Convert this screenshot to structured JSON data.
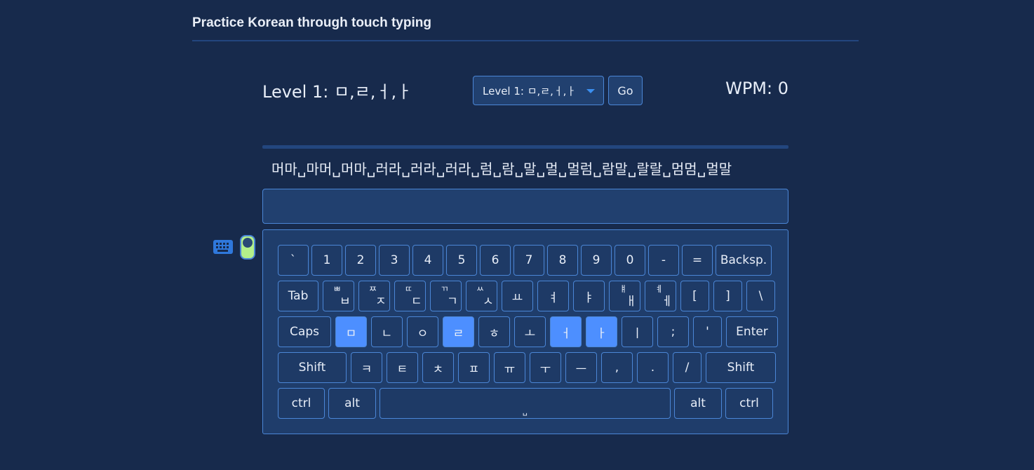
{
  "header": {
    "title": "Practice Korean through touch typing"
  },
  "controls": {
    "level_heading": "Level 1: ㅁ,ㄹ,ㅓ,ㅏ",
    "level_select": "Level 1: ㅁ,ㄹ,ㅓ,ㅏ",
    "go_label": "Go",
    "wpm": "WPM: 0"
  },
  "lesson": {
    "target_text": "머마␣마머␣머마␣러라␣러라␣러라␣럼␣람␣말␣멀␣멀럼␣람말␣랄랄␣멈멈␣멀말",
    "input_value": "",
    "progress": 0
  },
  "toggle": {
    "on": true,
    "icon": "keyboard-icon"
  },
  "colors": {
    "highlight": "#4d8fff",
    "toggle_on": "#b3f08a",
    "background": "#172a4c"
  },
  "keyboard": {
    "rows": [
      [
        {
          "label": "`"
        },
        {
          "label": "1"
        },
        {
          "label": "2"
        },
        {
          "label": "3"
        },
        {
          "label": "4"
        },
        {
          "label": "5"
        },
        {
          "label": "6"
        },
        {
          "label": "7"
        },
        {
          "label": "8"
        },
        {
          "label": "9"
        },
        {
          "label": "0"
        },
        {
          "label": "-"
        },
        {
          "label": "="
        },
        {
          "label": "Backsp."
        }
      ],
      [
        {
          "label": "Tab"
        },
        {
          "label": "ㅂ",
          "shift": "ㅃ"
        },
        {
          "label": "ㅈ",
          "shift": "ㅉ"
        },
        {
          "label": "ㄷ",
          "shift": "ㄸ"
        },
        {
          "label": "ㄱ",
          "shift": "ㄲ"
        },
        {
          "label": "ㅅ",
          "shift": "ㅆ"
        },
        {
          "label": "ㅛ"
        },
        {
          "label": "ㅕ"
        },
        {
          "label": "ㅑ"
        },
        {
          "label": "ㅐ",
          "shift": "ㅒ"
        },
        {
          "label": "ㅔ",
          "shift": "ㅖ"
        },
        {
          "label": "["
        },
        {
          "label": "]"
        },
        {
          "label": "\\"
        }
      ],
      [
        {
          "label": "Caps"
        },
        {
          "label": "ㅁ",
          "hl": true
        },
        {
          "label": "ㄴ"
        },
        {
          "label": "ㅇ"
        },
        {
          "label": "ㄹ",
          "hl": true
        },
        {
          "label": "ㅎ"
        },
        {
          "label": "ㅗ"
        },
        {
          "label": "ㅓ",
          "hl": true
        },
        {
          "label": "ㅏ",
          "hl": true
        },
        {
          "label": "ㅣ"
        },
        {
          "label": ";"
        },
        {
          "label": "'"
        },
        {
          "label": "Enter"
        }
      ],
      [
        {
          "label": "Shift"
        },
        {
          "label": "ㅋ"
        },
        {
          "label": "ㅌ"
        },
        {
          "label": "ㅊ"
        },
        {
          "label": "ㅍ"
        },
        {
          "label": "ㅠ"
        },
        {
          "label": "ㅜ"
        },
        {
          "label": "ㅡ"
        },
        {
          "label": ","
        },
        {
          "label": "."
        },
        {
          "label": "/"
        },
        {
          "label": "Shift"
        }
      ],
      [
        {
          "label": "ctrl"
        },
        {
          "label": "alt"
        },
        {
          "label": "␣"
        },
        {
          "label": "alt"
        },
        {
          "label": "ctrl"
        }
      ]
    ]
  }
}
